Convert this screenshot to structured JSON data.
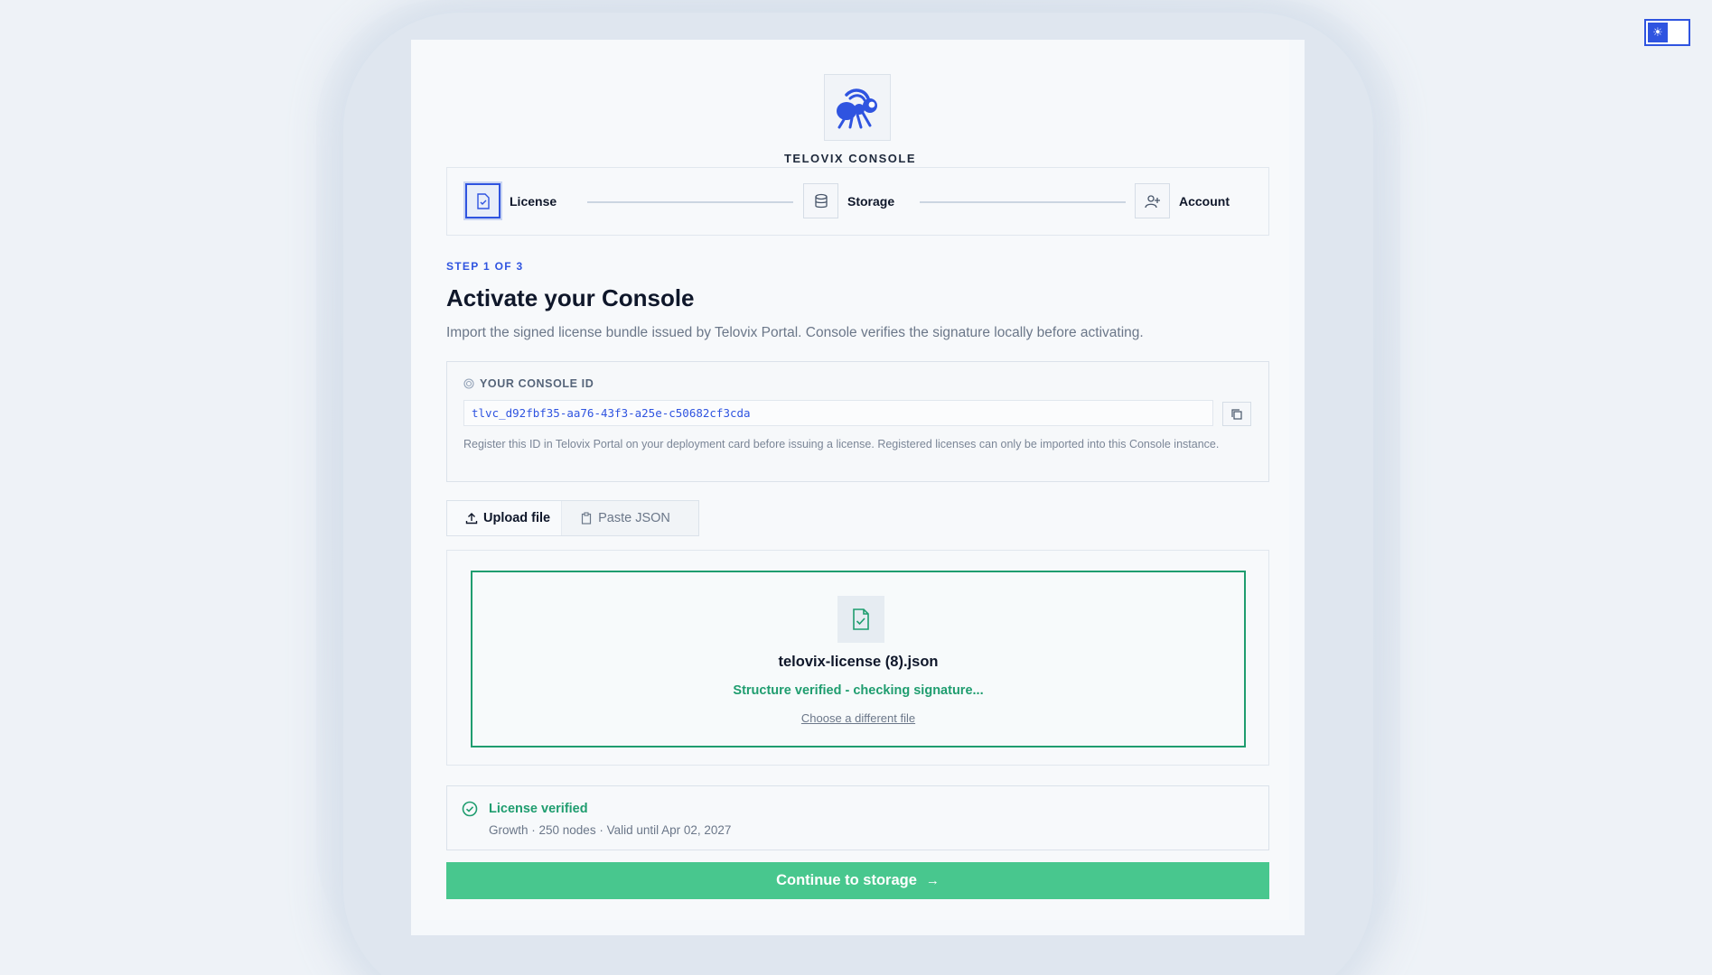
{
  "brand": {
    "name": "TELOVIX CONSOLE",
    "logo_icon": "ant-logo-icon",
    "accent": "#2f54e0"
  },
  "theme_toggle": {
    "icon": "sun-icon"
  },
  "stepper": {
    "steps": [
      {
        "label": "License",
        "icon": "file-check-icon",
        "state": "active"
      },
      {
        "label": "Storage",
        "icon": "database-icon",
        "state": "pending"
      },
      {
        "label": "Account",
        "icon": "user-plus-icon",
        "state": "pending"
      }
    ]
  },
  "header": {
    "kicker": "STEP 1 OF 3",
    "title": "Activate your Console",
    "subtitle": "Import the signed license bundle issued by Telovix Portal. Console verifies the signature locally before activating."
  },
  "console_id": {
    "label": "YOUR CONSOLE ID",
    "value": "tlvc_d92fbf35-aa76-43f3-a25e-c50682cf3cda",
    "help": "Register this ID in Telovix Portal on your deployment card before issuing a license. Registered licenses can only be imported into this Console instance."
  },
  "tabs": [
    {
      "label": "Upload file",
      "icon": "upload-icon",
      "active": true
    },
    {
      "label": "Paste JSON",
      "icon": "clipboard-icon",
      "active": false
    }
  ],
  "upload": {
    "file_name": "telovix-license (8).json",
    "status": "Structure verified - checking signature...",
    "change_link": "Choose a different file",
    "status_color": "#1f9d6f"
  },
  "verification": {
    "title": "License verified",
    "detail": "Growth · 250 nodes · Valid until Apr 02, 2027"
  },
  "actions": {
    "continue_label": "Continue to storage",
    "continue_color": "#48c78e"
  }
}
